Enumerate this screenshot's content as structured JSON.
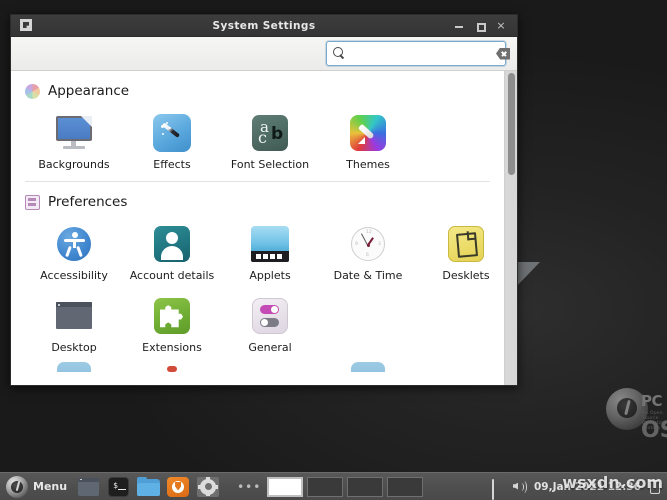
{
  "window": {
    "title": "System Settings",
    "menu_icon": "window-menu-icon",
    "minimize_label": "–",
    "maximize_label": "□",
    "close_label": "×"
  },
  "search": {
    "value": "",
    "placeholder": "",
    "icon": "search-icon",
    "clear_icon": "clear-icon"
  },
  "sections": [
    {
      "id": "appearance",
      "title": "Appearance",
      "icon": "color-wheel-icon",
      "items": [
        {
          "label": "Backgrounds",
          "icon": "backgrounds-icon"
        },
        {
          "label": "Effects",
          "icon": "effects-icon"
        },
        {
          "label": "Font Selection",
          "icon": "font-selection-icon"
        },
        {
          "label": "Themes",
          "icon": "themes-icon"
        }
      ]
    },
    {
      "id": "preferences",
      "title": "Preferences",
      "icon": "preferences-list-icon",
      "items": [
        {
          "label": "Accessibility",
          "icon": "accessibility-icon"
        },
        {
          "label": "Account details",
          "icon": "account-details-icon"
        },
        {
          "label": "Applets",
          "icon": "applets-icon"
        },
        {
          "label": "Date & Time",
          "icon": "date-time-icon"
        },
        {
          "label": "Desklets",
          "icon": "desklets-icon"
        },
        {
          "label": "Desktop",
          "icon": "desktop-icon"
        },
        {
          "label": "Extensions",
          "icon": "extensions-icon"
        },
        {
          "label": "General",
          "icon": "general-icon"
        }
      ]
    }
  ],
  "taskbar": {
    "menu_label": "Menu",
    "menu_icon": "mint-menu-orb-icon",
    "launchers": [
      {
        "name": "show-desktop-icon"
      },
      {
        "name": "terminal-icon",
        "glyph": "$_"
      },
      {
        "name": "file-manager-icon"
      },
      {
        "name": "firefox-icon"
      },
      {
        "name": "system-settings-icon"
      }
    ],
    "window_list_overflow": "•••",
    "windows": [
      {
        "name": "window-button-active",
        "active": true
      },
      {
        "name": "window-button-2",
        "active": false
      },
      {
        "name": "window-button-3",
        "active": false
      },
      {
        "name": "window-button-4",
        "active": false
      }
    ],
    "tray": {
      "display_icon": "display-icon",
      "volume_icon": "volume-icon",
      "clock": "09,Jan 2021 12:36",
      "trash_icon": "trash-icon"
    }
  },
  "desktop": {
    "logo_wordmark": "PC",
    "logo_tagline": "An Open Source Operating System",
    "logo_sub": "OS",
    "watermark": "wsxdn.com"
  }
}
